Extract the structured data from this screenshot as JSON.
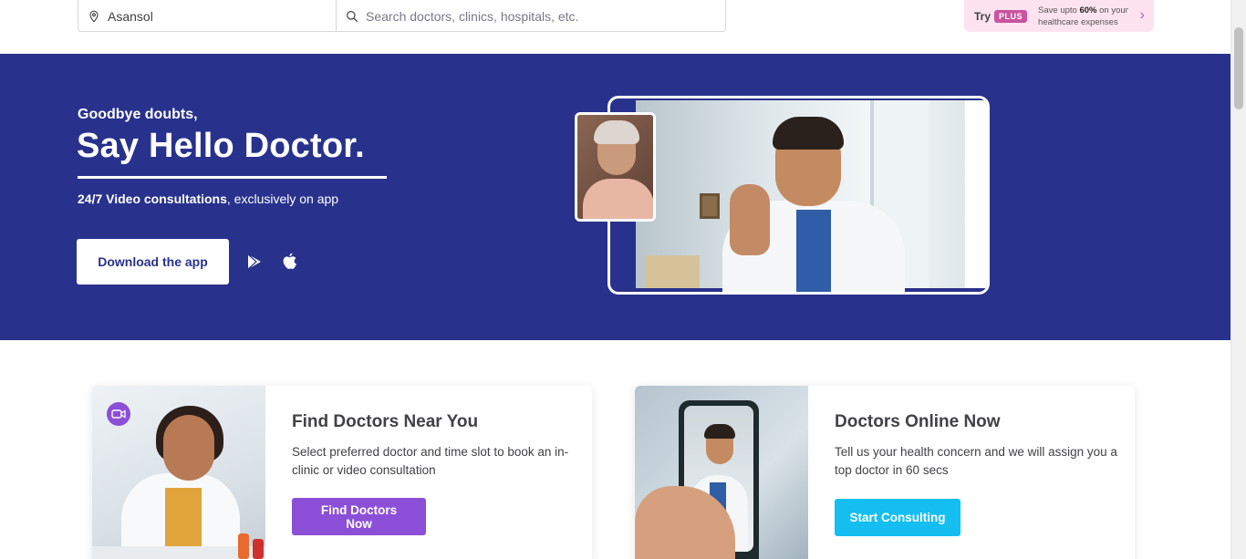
{
  "header": {
    "location_value": "Asansol",
    "search_placeholder": "Search doctors, clinics, hospitals, etc.",
    "plus_promo": {
      "try_label": "Try",
      "badge": "PLUS",
      "save_prefix": "Save upto ",
      "save_percent": "60%",
      "save_suffix": " on your healthcare expenses"
    }
  },
  "hero": {
    "subtitle": "Goodbye doubts,",
    "title": "Say Hello Doctor.",
    "tag_bold": "24/7 Video consultations",
    "tag_rest": ", exclusively on app",
    "download_button": "Download the app",
    "background_color": "#28328c"
  },
  "cards": [
    {
      "title": "Find Doctors Near You",
      "description": "Select preferred doctor and time slot to book an in-clinic or video consultation",
      "button": "Find Doctors Now",
      "button_color": "#8c4fd7"
    },
    {
      "title": "Doctors Online Now",
      "description": "Tell us your health concern and we will assign you a top doctor in 60 secs",
      "button": "Start Consulting",
      "button_color": "#14bef0"
    }
  ],
  "icons": {
    "location": "location-pin-icon",
    "search": "search-icon",
    "play_store": "play-store-icon",
    "app_store": "apple-icon",
    "video": "video-camera-icon",
    "promo_arrow": "chevron-right-icon"
  }
}
